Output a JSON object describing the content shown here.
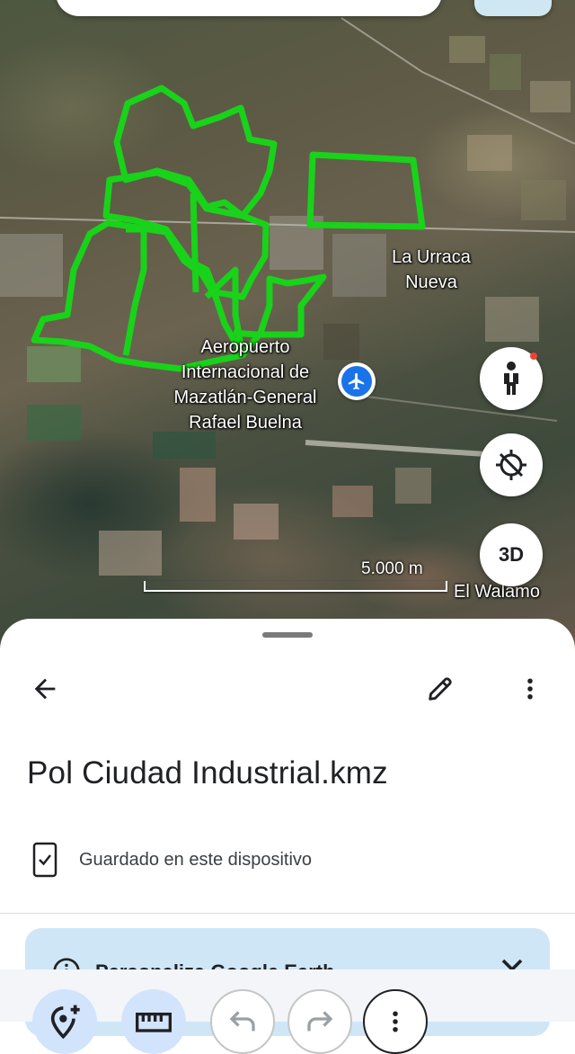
{
  "map": {
    "labels": {
      "la_urraca": "La Urraca\nNueva",
      "airport": "Aeropuerto\nInternacional de\nMazatlán-General\nRafael Buelna",
      "el_walamo": "El Walamo"
    },
    "scale_text": "5.000 m",
    "button_3d": "3D",
    "polygon_color": "#19d21a"
  },
  "sheet": {
    "title": "Pol Ciudad Industrial.kmz",
    "saved_status": "Guardado en este dispositivo",
    "banner_text": "Personaliza Google Earth"
  },
  "colors": {
    "accent_blue": "#1a73e8",
    "banner_bg": "#cfe6f7",
    "tool_filled_bg": "#d2e3fc"
  },
  "icons": {
    "back": "arrow-left-icon",
    "edit": "pencil-icon",
    "more": "more-vert-icon",
    "saved": "phone-check-icon",
    "info": "info-icon",
    "close": "close-icon",
    "pegman": "pegman-icon",
    "location": "location-off-icon",
    "airport": "airplane-icon",
    "add_place": "add-location-icon",
    "measure": "ruler-icon",
    "undo": "undo-icon",
    "redo": "redo-icon",
    "tool_more": "more-vert-icon"
  }
}
